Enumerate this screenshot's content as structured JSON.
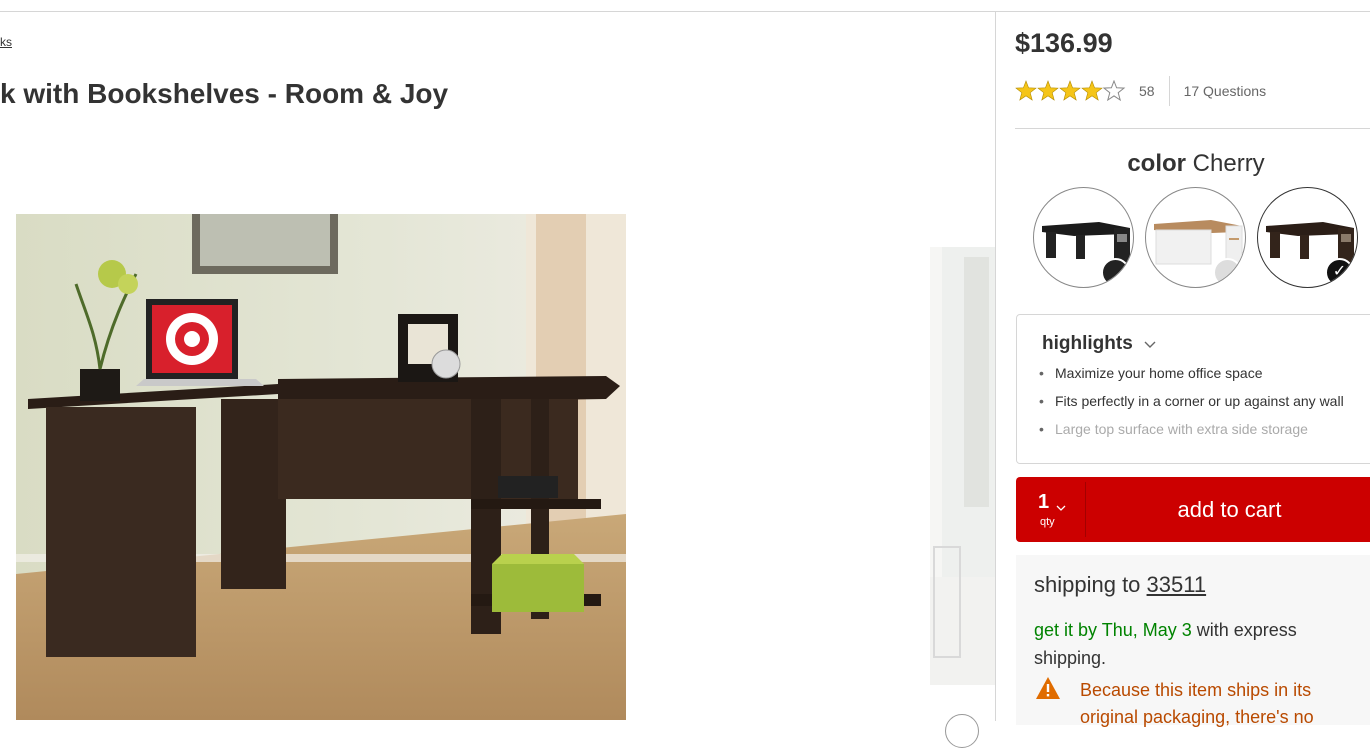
{
  "breadcrumb": {
    "fragment": "ks"
  },
  "product": {
    "title": "k with Bookshelves - Room & Joy"
  },
  "buybox": {
    "price": "$136.99",
    "rating_value": 4,
    "rating_max": 5,
    "rating_count": "58",
    "questions": "17 Questions"
  },
  "color": {
    "label": "color",
    "selected": "Cherry",
    "swatches": [
      {
        "name": "Black",
        "dot": "#222222",
        "selected": false
      },
      {
        "name": "White",
        "dot": "#dddddd",
        "selected": false
      },
      {
        "name": "Cherry",
        "dot": "#111111",
        "selected": true
      }
    ]
  },
  "highlights": {
    "title": "highlights",
    "items": [
      "Maximize your home office space",
      "Fits perfectly in a corner or up against any wall",
      "Large top surface with extra side storage"
    ]
  },
  "cart": {
    "qty": "1",
    "qty_label": "qty",
    "button": "add to cart"
  },
  "shipping": {
    "prefix": "shipping to",
    "zip": "33511",
    "date_green": "get it by Thu, May 3",
    "date_rest": " with express shipping.",
    "warning": "Because this item ships in its original packaging, there's no"
  },
  "colors": {
    "brand_red": "#cc0000",
    "green": "#008300",
    "warning": "#b94a00",
    "star": "#f5c518"
  }
}
